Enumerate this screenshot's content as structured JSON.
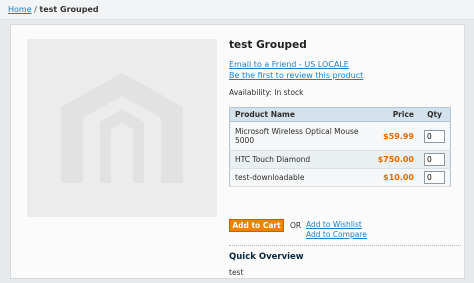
{
  "breadcrumb": {
    "home": "Home",
    "separator": "/",
    "current": "test Grouped"
  },
  "product": {
    "name": "test Grouped",
    "email_link": "Email to a Friend - US LOCALE",
    "review_link": "Be the first to review this product",
    "availability_label": "Availability:",
    "availability_value": "In stock"
  },
  "grouped_table": {
    "headers": {
      "name": "Product Name",
      "price": "Price",
      "qty": "Qty"
    },
    "rows": [
      {
        "name": "Microsoft Wireless Optical Mouse 5000",
        "price": "$59.99",
        "qty": "0"
      },
      {
        "name": "HTC Touch Diamond",
        "price": "$750.00",
        "qty": "0"
      },
      {
        "name": "test-downloadable",
        "price": "$10.00",
        "qty": "0"
      }
    ]
  },
  "actions": {
    "add_to_cart": "Add to Cart",
    "or": "OR",
    "wishlist": "Add to Wishlist",
    "compare": "Add to Compare"
  },
  "overview": {
    "title": "Quick Overview",
    "text": "test"
  },
  "colors": {
    "accent": "#f18200",
    "link": "#1e7ec8",
    "price": "#e46b00",
    "header_bg": "#d4e2ee"
  },
  "icons": {
    "product_placeholder": "magento-logo-placeholder"
  }
}
